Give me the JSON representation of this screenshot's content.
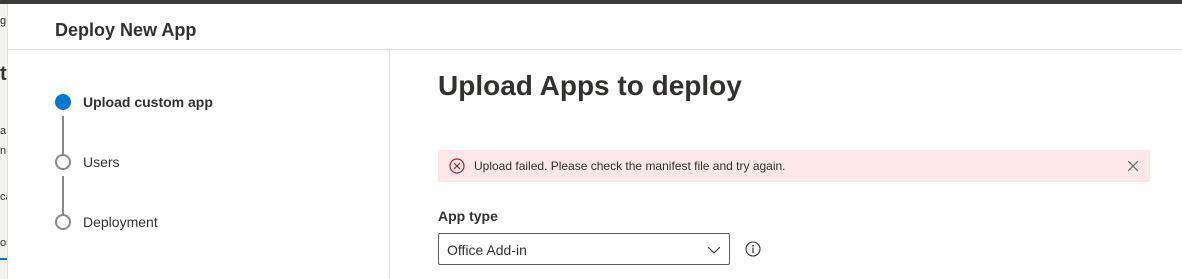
{
  "background": {
    "fragments": [
      "g",
      "t",
      "a",
      "n",
      "ca",
      "os"
    ]
  },
  "panel": {
    "title": "Deploy New App"
  },
  "steps": [
    {
      "label": "Upload custom app",
      "state": "active"
    },
    {
      "label": "Users",
      "state": "pending"
    },
    {
      "label": "Deployment",
      "state": "pending"
    }
  ],
  "main": {
    "title": "Upload Apps to deploy",
    "error": {
      "message": "Upload failed. Please check the manifest file and try again.",
      "icon": "error-badge-icon",
      "dismiss_icon": "close-icon"
    },
    "app_type": {
      "label": "App type",
      "value": "Office Add-in",
      "icon": "chevron-down-icon",
      "info_icon": "info-icon"
    }
  },
  "colors": {
    "accent": "#0078d4",
    "error_bg": "#fde7e9",
    "error_icon": "#a4262c",
    "text": "#323130",
    "border": "#e1dfdd"
  }
}
